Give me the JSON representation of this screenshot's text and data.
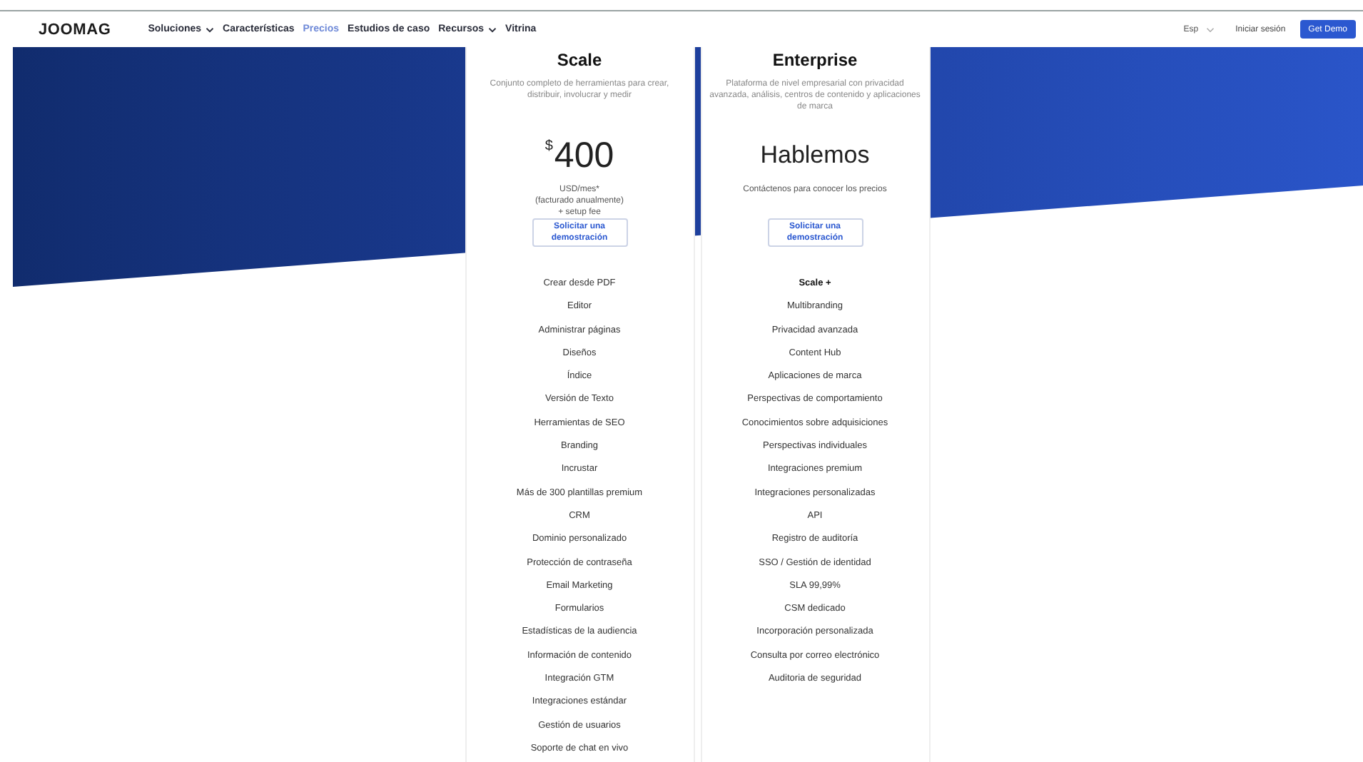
{
  "nav": {
    "logo": "JOOMAG",
    "items": [
      {
        "label": "Soluciones",
        "dropdown": true,
        "selected": false
      },
      {
        "label": "Características",
        "dropdown": false,
        "selected": false
      },
      {
        "label": "Precios",
        "dropdown": false,
        "selected": true
      },
      {
        "label": "Estudios de caso",
        "dropdown": false,
        "selected": false
      },
      {
        "label": "Recursos",
        "dropdown": true,
        "selected": false
      },
      {
        "label": "Vitrina",
        "dropdown": false,
        "selected": false
      }
    ],
    "language": "Esp",
    "login": "Iniciar sesión",
    "cta": "Get Demo"
  },
  "plans": [
    {
      "name": "Scale",
      "description": "Conjunto completo de herramientas para crear, distribuir, involucrar y medir",
      "kind": "price",
      "currency": "$",
      "price": "400",
      "price_note": [
        "USD/mes*",
        "(facturado anualmente)",
        "+ setup fee"
      ],
      "button": "Solicitar una demostración",
      "features": [
        {
          "text": "Crear desde PDF",
          "bold": false
        },
        {
          "text": "Editor",
          "bold": false
        },
        {
          "text": "Administrar páginas",
          "bold": false
        },
        {
          "text": "Diseños",
          "bold": false
        },
        {
          "text": "Índice",
          "bold": false
        },
        {
          "text": "Versión de Texto",
          "bold": false
        },
        {
          "text": "Herramientas de SEO",
          "bold": false
        },
        {
          "text": "Branding",
          "bold": false
        },
        {
          "text": "Incrustar",
          "bold": false
        },
        {
          "text": "Más de 300 plantillas premium",
          "bold": false
        },
        {
          "text": "CRM",
          "bold": false
        },
        {
          "text": "Dominio personalizado",
          "bold": false
        },
        {
          "text": "Protección de contraseña",
          "bold": false
        },
        {
          "text": "Email Marketing",
          "bold": false
        },
        {
          "text": "Formularios",
          "bold": false
        },
        {
          "text": "Estadísticas de la audiencia",
          "bold": false
        },
        {
          "text": "Información de contenido",
          "bold": false
        },
        {
          "text": "Integración GTM",
          "bold": false
        },
        {
          "text": "Integraciones estándar",
          "bold": false
        },
        {
          "text": "Gestión de usuarios",
          "bold": false
        },
        {
          "text": "Soporte de chat en vivo",
          "bold": false
        }
      ]
    },
    {
      "name": "Enterprise",
      "description": "Plataforma de nivel empresarial con privacidad avanzada, análisis, centros de contenido y aplicaciones de marca",
      "kind": "contact",
      "headline": "Hablemos",
      "price_note": [
        "Contáctenos para conocer los precios"
      ],
      "button": "Solicitar una demostración",
      "features": [
        {
          "text": "Scale +",
          "bold": true
        },
        {
          "text": "Multibranding",
          "bold": false
        },
        {
          "text": "Privacidad avanzada",
          "bold": false
        },
        {
          "text": "Content Hub",
          "bold": false
        },
        {
          "text": "Aplicaciones de marca",
          "bold": false
        },
        {
          "text": "Perspectivas de comportamiento",
          "bold": false
        },
        {
          "text": "Conocimientos sobre adquisiciones",
          "bold": false
        },
        {
          "text": "Perspectivas individuales",
          "bold": false
        },
        {
          "text": "Integraciones premium",
          "bold": false
        },
        {
          "text": "Integraciones personalizadas",
          "bold": false
        },
        {
          "text": "API",
          "bold": false
        },
        {
          "text": "Registro de auditoría",
          "bold": false
        },
        {
          "text": "SSO / Gestión de identidad",
          "bold": false
        },
        {
          "text": "SLA 99,99%",
          "bold": false
        },
        {
          "text": "CSM dedicado",
          "bold": false
        },
        {
          "text": "Incorporación personalizada",
          "bold": false
        },
        {
          "text": "Consulta por correo electrónico",
          "bold": false
        },
        {
          "text": "Auditoria de seguridad",
          "bold": false
        }
      ]
    }
  ]
}
